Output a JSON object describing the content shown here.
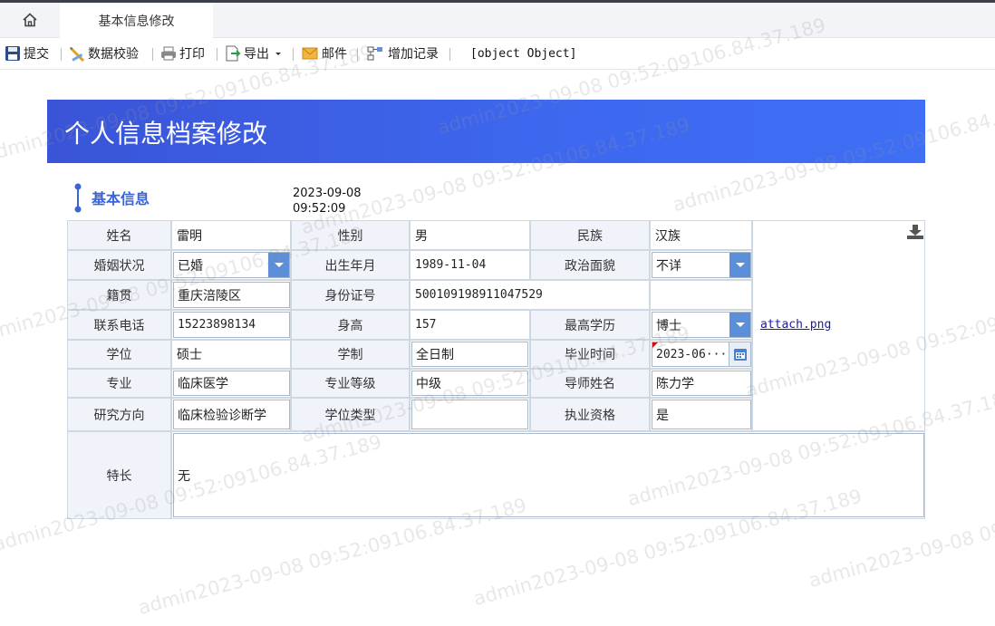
{
  "tabs": {
    "active_label": "基本信息修改"
  },
  "toolbar": {
    "submit": "提交",
    "validate": "数据校验",
    "print": "打印",
    "export": "导出",
    "mail": "邮件",
    "add_record": "增加记录",
    "object_text": "[object Object]"
  },
  "banner": {
    "title": "个人信息档案修改"
  },
  "section": {
    "title": "基本信息",
    "date": "2023-09-08",
    "time": "09:52:09"
  },
  "form": {
    "name_label": "姓名",
    "name_value": "雷明",
    "gender_label": "性别",
    "gender_value": "男",
    "ethnic_label": "民族",
    "ethnic_value": "汉族",
    "marital_label": "婚姻状况",
    "marital_value": "已婚",
    "birth_label": "出生年月",
    "birth_value": "1989-11-04",
    "political_label": "政治面貌",
    "political_value": "不详",
    "native_label": "籍贯",
    "native_value": "重庆涪陵区",
    "idcard_label": "身份证号",
    "idcard_value": "500109198911047529",
    "phone_label": "联系电话",
    "phone_value": "15223898134",
    "height_label": "身高",
    "height_value": "157",
    "edu_label": "最高学历",
    "edu_value": "博士",
    "degree_label": "学位",
    "degree_value": "硕士",
    "schooling_label": "学制",
    "schooling_value": "全日制",
    "grad_label": "毕业时间",
    "grad_value": "2023-06···",
    "major_label": "专业",
    "major_value": "临床医学",
    "major_level_label": "专业等级",
    "major_level_value": "中级",
    "tutor_label": "导师姓名",
    "tutor_value": "陈力学",
    "research_label": "研究方向",
    "research_value": "临床检验诊断学",
    "degree_type_label": "学位类型",
    "degree_type_value": "",
    "license_label": "执业资格",
    "license_value": "是",
    "specialty_label": "特长",
    "specialty_value": "无",
    "attachment": "attach.png"
  },
  "watermark": {
    "lines": [
      "admin2023-09-08 09:52:09106.84.37.189",
      "admin2023-09-08 09:52:09106.84.37.189",
      "admin2023-09-08 09:52:09106.84.37.189",
      "admin2023-09-08 09:52:09106.84.37.189",
      "admin2023-09-08 09:52:09106.84.37.189",
      "admin2023-09-08 09:52:09106.84.37.189",
      "admin2023-09-08 09:52:09106.84.37.189",
      "admin2023-09-08 09:52:09106.84.37.189",
      "admin2023-09-08 09:52:09106.84.37.189",
      "admin2023-09-08 09:52:09106.84.37.189",
      "admin2023-09-08 09:52:09106.84.37.189",
      "admin2023-09-08 09:52:09106.84.37.189"
    ]
  },
  "icons": {
    "home": "home-icon",
    "save": "save-icon",
    "validate": "pencil-ruler-icon",
    "print": "printer-icon",
    "export": "export-icon",
    "mail": "envelope-icon",
    "add": "add-record-icon",
    "download": "download-icon",
    "calendar": "calendar-icon"
  },
  "colors": {
    "banner": "#3d67ee",
    "section_title": "#3a63d8",
    "select_button": "#5b8fd9",
    "label_bg": "#f0f4fa"
  }
}
